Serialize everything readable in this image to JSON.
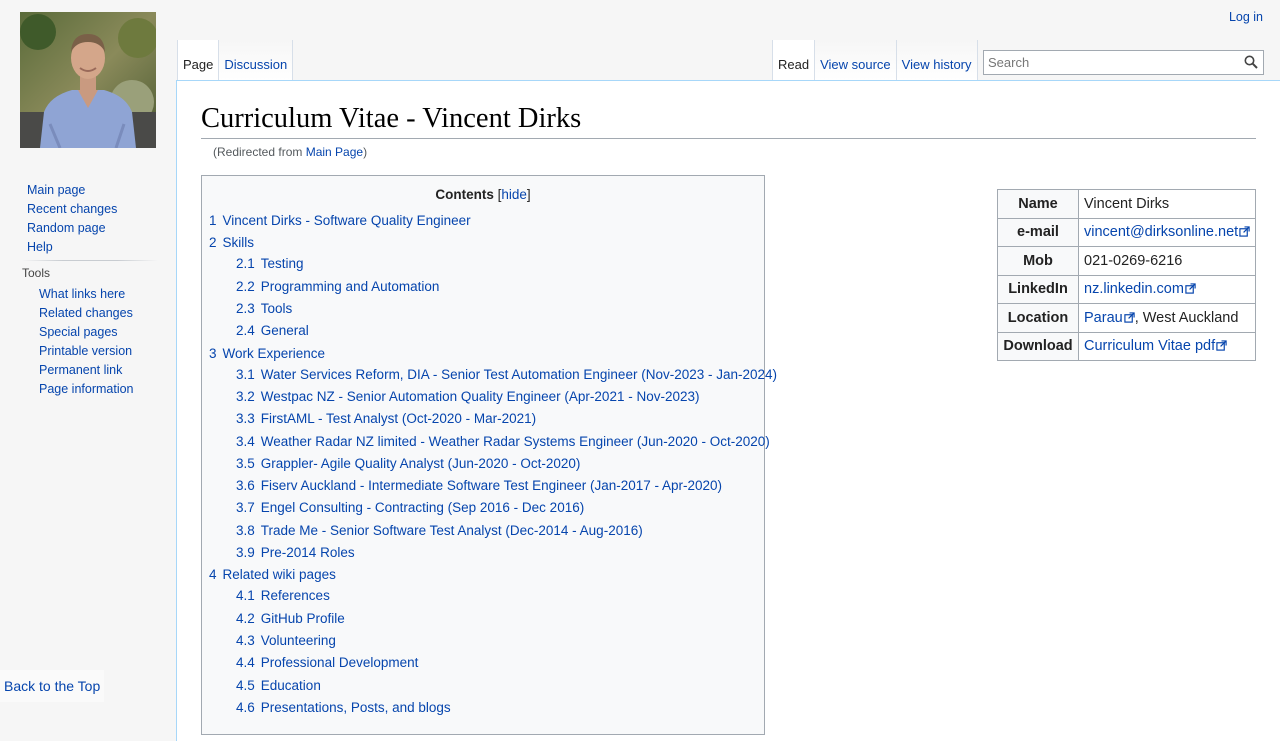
{
  "header": {
    "login_label": "Log in",
    "left_tabs": [
      "Page",
      "Discussion"
    ],
    "right_tabs": [
      "Read",
      "View source",
      "View history"
    ],
    "search_placeholder": "Search"
  },
  "sidebar": {
    "main_items": [
      "Main page",
      "Recent changes",
      "Random page",
      "Help"
    ],
    "tools_heading": "Tools",
    "tools_items": [
      "What links here",
      "Related changes",
      "Special pages",
      "Printable version",
      "Permanent link",
      "Page information"
    ],
    "back_to_top": "Back to the Top"
  },
  "page": {
    "title": "Curriculum Vitae - Vincent Dirks",
    "redirect_prefix": "(Redirected from ",
    "redirect_link": "Main Page",
    "redirect_suffix": ")"
  },
  "toc": {
    "title": "Contents",
    "hide_open": " [",
    "hide_label": "hide",
    "hide_close": "]",
    "items": [
      {
        "num": "1",
        "text": "Vincent Dirks - Software Quality Engineer",
        "level": 1
      },
      {
        "num": "2",
        "text": "Skills",
        "level": 1
      },
      {
        "num": "2.1",
        "text": "Testing",
        "level": 2
      },
      {
        "num": "2.2",
        "text": "Programming and Automation",
        "level": 2
      },
      {
        "num": "2.3",
        "text": "Tools",
        "level": 2
      },
      {
        "num": "2.4",
        "text": "General",
        "level": 2
      },
      {
        "num": "3",
        "text": "Work Experience",
        "level": 1
      },
      {
        "num": "3.1",
        "text": "Water Services Reform, DIA - Senior Test Automation Engineer (Nov-2023 - Jan-2024)",
        "level": 2
      },
      {
        "num": "3.2",
        "text": "Westpac NZ - Senior Automation Quality Engineer (Apr-2021 - Nov-2023)",
        "level": 2
      },
      {
        "num": "3.3",
        "text": "FirstAML - Test Analyst (Oct-2020 - Mar-2021)",
        "level": 2
      },
      {
        "num": "3.4",
        "text": "Weather Radar NZ limited - Weather Radar Systems Engineer (Jun-2020 - Oct-2020)",
        "level": 2
      },
      {
        "num": "3.5",
        "text": "Grappler- Agile Quality Analyst (Jun-2020 - Oct-2020)",
        "level": 2
      },
      {
        "num": "3.6",
        "text": "Fiserv Auckland - Intermediate Software Test Engineer (Jan-2017 - Apr-2020)",
        "level": 2
      },
      {
        "num": "3.7",
        "text": "Engel Consulting - Contracting (Sep 2016 - Dec 2016)",
        "level": 2
      },
      {
        "num": "3.8",
        "text": "Trade Me - Senior Software Test Analyst (Dec-2014 - Aug-2016)",
        "level": 2
      },
      {
        "num": "3.9",
        "text": "Pre-2014 Roles",
        "level": 2
      },
      {
        "num": "4",
        "text": "Related wiki pages",
        "level": 1
      },
      {
        "num": "4.1",
        "text": "References",
        "level": 2
      },
      {
        "num": "4.2",
        "text": "GitHub Profile",
        "level": 2
      },
      {
        "num": "4.3",
        "text": "Volunteering",
        "level": 2
      },
      {
        "num": "4.4",
        "text": "Professional Development",
        "level": 2
      },
      {
        "num": "4.5",
        "text": "Education",
        "level": 2
      },
      {
        "num": "4.6",
        "text": "Presentations, Posts, and blogs",
        "level": 2
      }
    ]
  },
  "infobox": {
    "rows": [
      {
        "key": "Name",
        "value": "Vincent Dirks",
        "link": false,
        "external": false,
        "suffix": ""
      },
      {
        "key": "e-mail",
        "value": "vincent@dirksonline.net",
        "link": true,
        "external": true,
        "suffix": ""
      },
      {
        "key": "Mob",
        "value": "021-0269-6216",
        "link": false,
        "external": false,
        "suffix": ""
      },
      {
        "key": "LinkedIn",
        "value": "nz.linkedin.com",
        "link": true,
        "external": true,
        "suffix": ""
      },
      {
        "key": "Location",
        "value": "Parau",
        "link": true,
        "external": true,
        "suffix": ", West Auckland"
      },
      {
        "key": "Download",
        "value": "Curriculum Vitae pdf",
        "link": true,
        "external": true,
        "suffix": ""
      }
    ]
  },
  "colors": {
    "link": "#0645ad",
    "tab_border": "#a7d7f9",
    "box_border": "#a2a9b1"
  }
}
